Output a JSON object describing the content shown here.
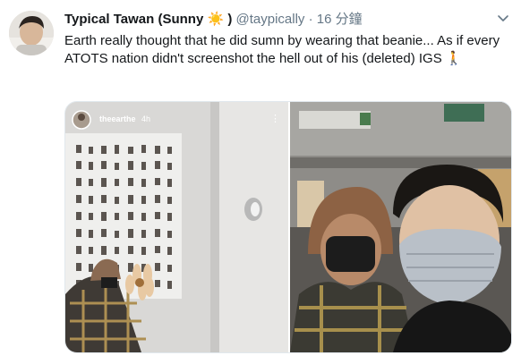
{
  "tweet": {
    "display_name": "Typical Tawan (Sunny",
    "name_emoji": "☀️",
    "name_close": ")",
    "handle": "@taypically",
    "separator": "·",
    "time": "16 分鐘",
    "text": "Earth really thought that he did sumn by wearing that beanie... As if every ATOTS nation didn't screenshot the hell out of his (deleted) IGS 🚶"
  },
  "story_overlay": {
    "username": "theearthe",
    "age": "4h",
    "menu": "⋮"
  },
  "icons": {
    "more": "chevron-down-icon",
    "avatar": "user-avatar",
    "story_avatar": "story-avatar"
  },
  "colors": {
    "meta": "#657786",
    "text": "#14171a",
    "border": "#e1e8ed"
  }
}
